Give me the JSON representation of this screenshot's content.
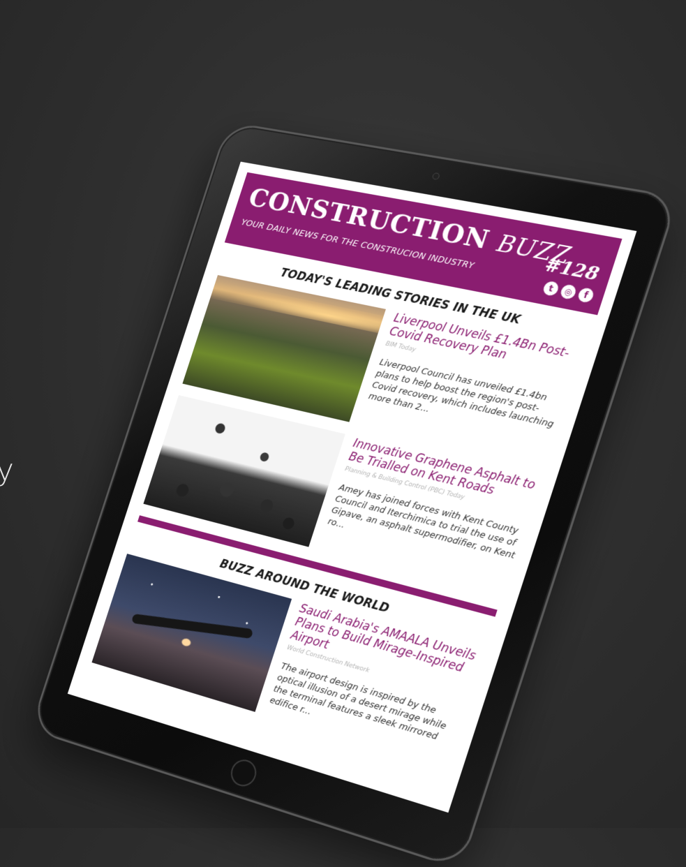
{
  "background": {
    "edge_text": "y"
  },
  "newsletter": {
    "brand_main": "CONSTRUCTION",
    "brand_sub": "BUZZ",
    "tagline": "YOUR DAILY NEWS FOR THE CONSTRUCION INDUSTRY",
    "issue": "#128",
    "social": [
      "twitter-icon",
      "instagram-icon",
      "facebook-icon"
    ],
    "accent_color": "#8a1d70"
  },
  "sections": [
    {
      "heading": "TODAY'S LEADING STORIES IN THE UK",
      "stories": [
        {
          "title": "Liverpool Unveils £1.4Bn Post-Covid Recovery Plan",
          "source": "BIM Today",
          "excerpt": "Liverpool Council has unveiled £1.4bn plans to help boost the region's post-Covid recovery, which includes launching more than 2..."
        },
        {
          "title": "Innovative Graphene Asphalt to Be Trialled on Kent Roads",
          "source": "Planning & Building Control (PBC) Today",
          "excerpt": "Amey has joined forces with Kent County Council and Iterchimica to trial the use of Gipave, an asphalt supermodifier, on Kent ro..."
        }
      ]
    },
    {
      "heading": "BUZZ AROUND THE WORLD",
      "stories": [
        {
          "title": "Saudi Arabia's AMAALA Unveils Plans to Build Mirage-Inspired Airport",
          "source": "World Construction Network",
          "excerpt": "The airport design is inspired by the optical illusion of a desert mirage while the terminal features a sleek mirrored edifice r..."
        }
      ]
    }
  ]
}
